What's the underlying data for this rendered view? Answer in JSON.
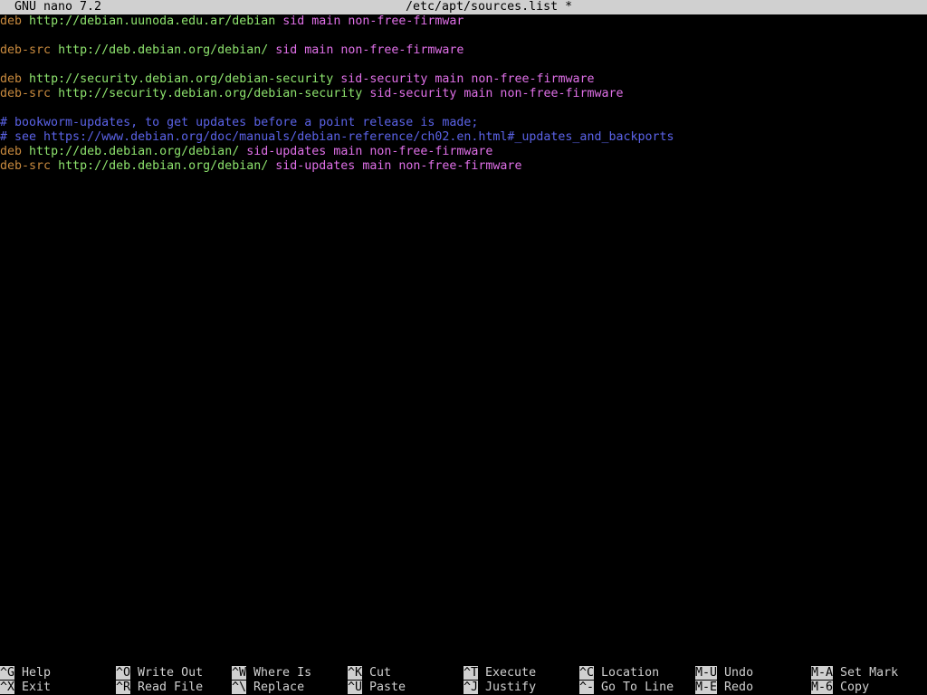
{
  "titlebar": {
    "app_version": "GNU nano 7.2",
    "file_path": "/etc/apt/sources.list *"
  },
  "colors": {
    "background": "#000000",
    "keyword": "#c88a3e",
    "url": "#8ee46e",
    "suite_and_components": "#e070e8",
    "comment": "#5b63e8",
    "bar": "#d0d0d0"
  },
  "file_lines": [
    {
      "type": "entry",
      "kind": "deb",
      "url": "http://debian.uunoda.edu.ar/debian",
      "suite": "sid",
      "components": "main non-free-firmwar"
    },
    {
      "type": "blank"
    },
    {
      "type": "entry",
      "kind": "deb-src",
      "url": "http://deb.debian.org/debian/",
      "suite": "sid",
      "components": "main non-free-firmware"
    },
    {
      "type": "blank"
    },
    {
      "type": "entry",
      "kind": "deb",
      "url": "http://security.debian.org/debian-security",
      "suite": "sid-security",
      "components": "main non-free-firmware"
    },
    {
      "type": "entry",
      "kind": "deb-src",
      "url": "http://security.debian.org/debian-security",
      "suite": "sid-security",
      "components": "main non-free-firmware"
    },
    {
      "type": "blank"
    },
    {
      "type": "comment",
      "text": "# bookworm-updates, to get updates before a point release is made;"
    },
    {
      "type": "comment",
      "text": "# see https://www.debian.org/doc/manuals/debian-reference/ch02.en.html#_updates_and_backports"
    },
    {
      "type": "entry",
      "kind": "deb",
      "url": "http://deb.debian.org/debian/",
      "suite": "sid-updates",
      "components": "main non-free-firmware"
    },
    {
      "type": "entry",
      "kind": "deb-src",
      "url": "http://deb.debian.org/debian/",
      "suite": "sid-updates",
      "components": "main non-free-firmware"
    }
  ],
  "shortcuts": {
    "help": {
      "key": "^G",
      "label": "Help"
    },
    "exit": {
      "key": "^X",
      "label": "Exit"
    },
    "write_out": {
      "key": "^O",
      "label": "Write Out"
    },
    "read_file": {
      "key": "^R",
      "label": "Read File"
    },
    "where_is": {
      "key": "^W",
      "label": "Where Is"
    },
    "replace": {
      "key": "^\\",
      "label": "Replace"
    },
    "cut": {
      "key": "^K",
      "label": "Cut"
    },
    "paste": {
      "key": "^U",
      "label": "Paste"
    },
    "execute": {
      "key": "^T",
      "label": "Execute"
    },
    "justify": {
      "key": "^J",
      "label": "Justify"
    },
    "location": {
      "key": "^C",
      "label": "Location"
    },
    "go_to_line": {
      "key": "^-",
      "label": "Go To Line"
    },
    "undo": {
      "key": "M-U",
      "label": "Undo"
    },
    "redo": {
      "key": "M-E",
      "label": "Redo"
    },
    "set_mark": {
      "key": "M-A",
      "label": "Set Mark"
    },
    "copy": {
      "key": "M-6",
      "label": "Copy"
    }
  }
}
